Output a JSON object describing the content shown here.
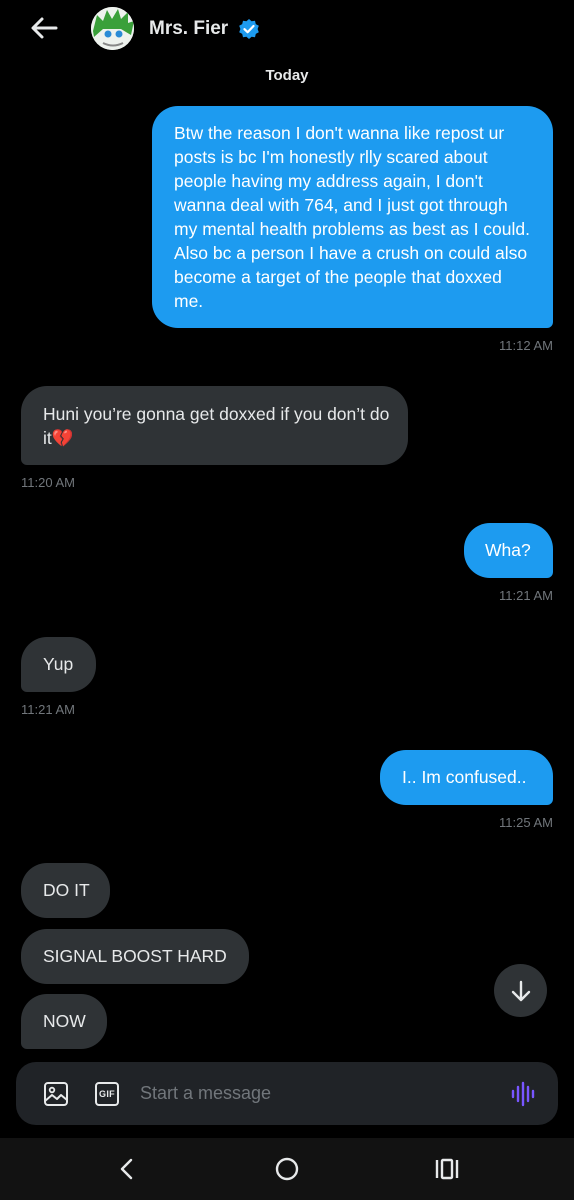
{
  "header": {
    "contact_name": "Mrs. Fier",
    "avatar_icon": "avatar",
    "back_icon": "arrow-left-icon",
    "verified_icon": "verified-badge-icon"
  },
  "day_label": "Today",
  "messages": [
    {
      "side": "sent",
      "text": "Btw the reason I don't wanna like repost ur posts is bc I'm honestly rlly scared about people having my address again, I don't wanna deal with 764, and I just got through my mental health problems as best as I could. Also bc a person I have a crush on could also become a target of the people that doxxed me.",
      "time": "11:12 AM"
    },
    {
      "side": "received",
      "text": "Huni you’re gonna get doxxed if you don’t do it",
      "emoji": "💔",
      "time": "11:20 AM"
    },
    {
      "side": "sent",
      "text": "Wha?",
      "time": "11:21 AM"
    },
    {
      "side": "received",
      "text": "Yup",
      "time": "11:21 AM"
    },
    {
      "side": "sent",
      "text": "I.. Im confused..",
      "time": "11:25 AM"
    },
    {
      "side": "received",
      "text": "DO IT"
    },
    {
      "side": "received",
      "text": "SIGNAL BOOST HARD"
    },
    {
      "side": "received",
      "text": "NOW"
    }
  ],
  "composer": {
    "placeholder": "Start a message",
    "image_icon": "image-icon",
    "gif_label": "GIF",
    "voice_icon": "voice-waveform-icon"
  },
  "scroll_down_icon": "arrow-down-icon",
  "system_nav": {
    "back_icon": "nav-back-icon",
    "home_icon": "nav-home-icon",
    "recents_icon": "nav-recents-icon"
  },
  "colors": {
    "accent": "#1d9bf0",
    "background": "#000000",
    "received_bubble": "#2f3336",
    "timestamp": "#71767b"
  }
}
